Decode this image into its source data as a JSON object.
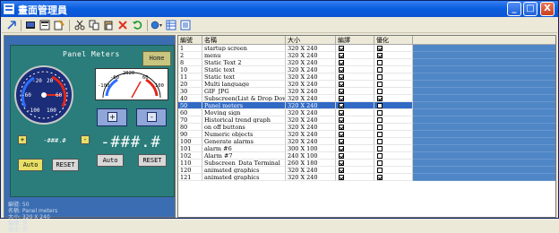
{
  "window": {
    "title": "畫面管理員",
    "minimize": "_",
    "maximize": "□",
    "close": "X"
  },
  "toolbar": {
    "icons": [
      "arrow-icon",
      "screen-icon",
      "window-icon",
      "properties-icon",
      "cut-icon",
      "copy-icon",
      "paste-icon",
      "delete-icon",
      "refresh-icon",
      "color-icon",
      "grid-icon",
      "list-icon"
    ]
  },
  "preview": {
    "title": "Panel Meters",
    "home": "Home",
    "gauge1_ticks": [
      "-20",
      "20",
      "-60",
      "60",
      "-100",
      "100"
    ],
    "gauge2_ticks": [
      "-100",
      "-60",
      "2020",
      "60",
      "100"
    ],
    "small_readout": "-###.#",
    "display": "-###.#",
    "auto1": "Auto",
    "reset1": "RESET",
    "auto2": "Auto",
    "reset2": "RESET",
    "plus": "+",
    "minus": "-",
    "info": [
      "編號: 50",
      "名稱: Panel meters",
      "大小: 320 X 240",
      "編譯: 是",
      "優化: 否"
    ]
  },
  "table": {
    "columns": [
      "編號",
      "名稱",
      "大小",
      "編譯",
      "優化"
    ],
    "rows": [
      {
        "id": "1",
        "name": "startup screen",
        "size": "320 X 240",
        "compile": true,
        "optimize": true
      },
      {
        "id": "2",
        "name": "menu",
        "size": "320 X 240",
        "compile": true,
        "optimize": true
      },
      {
        "id": "8",
        "name": "Static Text 2",
        "size": "320 X 240",
        "compile": true,
        "optimize": false
      },
      {
        "id": "10",
        "name": "Static text",
        "size": "320 X 240",
        "compile": true,
        "optimize": false
      },
      {
        "id": "11",
        "name": "Static text",
        "size": "320 X 240",
        "compile": true,
        "optimize": false
      },
      {
        "id": "20",
        "name": "Multi language",
        "size": "320 X 240",
        "compile": true,
        "optimize": false
      },
      {
        "id": "30",
        "name": "GIF_JPG",
        "size": "320 X 240",
        "compile": true,
        "optimize": false
      },
      {
        "id": "40",
        "name": "Subscreen(List & Drop Dow...",
        "size": "320 X 240",
        "compile": true,
        "optimize": true
      },
      {
        "id": "50",
        "name": "Panel meters",
        "size": "320 X 240",
        "compile": true,
        "optimize": false,
        "selected": true
      },
      {
        "id": "60",
        "name": "Moving sign",
        "size": "320 X 240",
        "compile": true,
        "optimize": false
      },
      {
        "id": "70",
        "name": "Historical trend graph",
        "size": "320 X 240",
        "compile": true,
        "optimize": false
      },
      {
        "id": "80",
        "name": "on off buttons",
        "size": "320 X 240",
        "compile": true,
        "optimize": false
      },
      {
        "id": "90",
        "name": "Numeric objects",
        "size": "320 X 240",
        "compile": true,
        "optimize": false
      },
      {
        "id": "100",
        "name": "Generate alarms",
        "size": "320 X 240",
        "compile": true,
        "optimize": false
      },
      {
        "id": "101",
        "name": "alarm #6",
        "size": "300 X 100",
        "compile": true,
        "optimize": false
      },
      {
        "id": "102",
        "name": "Alarm #7",
        "size": "240 X 100",
        "compile": true,
        "optimize": false
      },
      {
        "id": "110",
        "name": "Subscreen_Data Terminal",
        "size": "260 X 180",
        "compile": true,
        "optimize": false
      },
      {
        "id": "120",
        "name": "animated graphics",
        "size": "320 X 240",
        "compile": true,
        "optimize": false
      },
      {
        "id": "121",
        "name": "animated graphics",
        "size": "320 X 240",
        "compile": true,
        "optimize": true
      }
    ]
  }
}
